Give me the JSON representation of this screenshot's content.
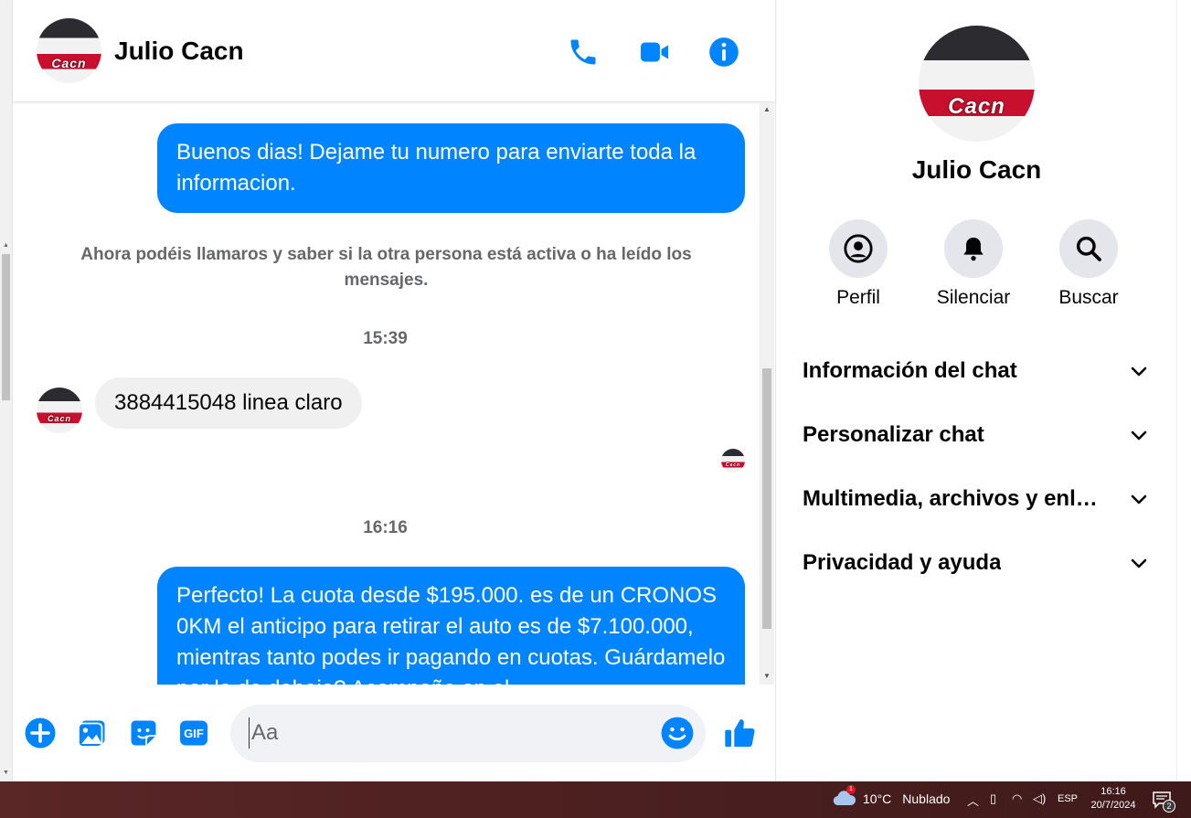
{
  "chat": {
    "contact_name": "Julio Cacn",
    "avatar_text": "Cacn",
    "header_icons": [
      "phone-icon",
      "video-camera-icon",
      "info-icon"
    ],
    "messages": {
      "out1": "Buenos dias! Dejame tu numero para enviarte toda la informacion.",
      "system_note": "Ahora podéis llamaros y saber si la otra persona está activa o ha leído los mensajes.",
      "time1": "15:39",
      "in1": "3884415048 linea claro",
      "time2": "16:16",
      "out2": "Perfecto! La cuota desde $195.000. es de un CRONOS 0KM el anticipo para retirar el auto es de $7.100.000, mientras tanto podes ir pagando en cuotas. Guárdamelo por lo de debajo? Acompaña en el"
    },
    "composer": {
      "placeholder": "Aa",
      "icons": [
        "plus-icon",
        "image-icon",
        "sticker-icon",
        "gif-icon",
        "emoji-icon",
        "thumbs-up-icon"
      ],
      "gif_label": "GIF"
    },
    "accent_color": "#0084ff"
  },
  "profile": {
    "name": "Julio Cacn",
    "actions": [
      {
        "label": "Perfil",
        "icon": "profile-icon"
      },
      {
        "label": "Silenciar",
        "icon": "bell-icon"
      },
      {
        "label": "Buscar",
        "icon": "search-icon"
      }
    ],
    "sections": [
      "Información del chat",
      "Personalizar chat",
      "Multimedia, archivos y enlaces",
      "Privacidad y ayuda"
    ]
  },
  "taskbar": {
    "weather_temp": "10°C",
    "weather_desc": "Nublado",
    "weather_badge": "1",
    "language": "ESP",
    "time": "16:16",
    "date": "20/7/2024",
    "notification_count": "2"
  }
}
